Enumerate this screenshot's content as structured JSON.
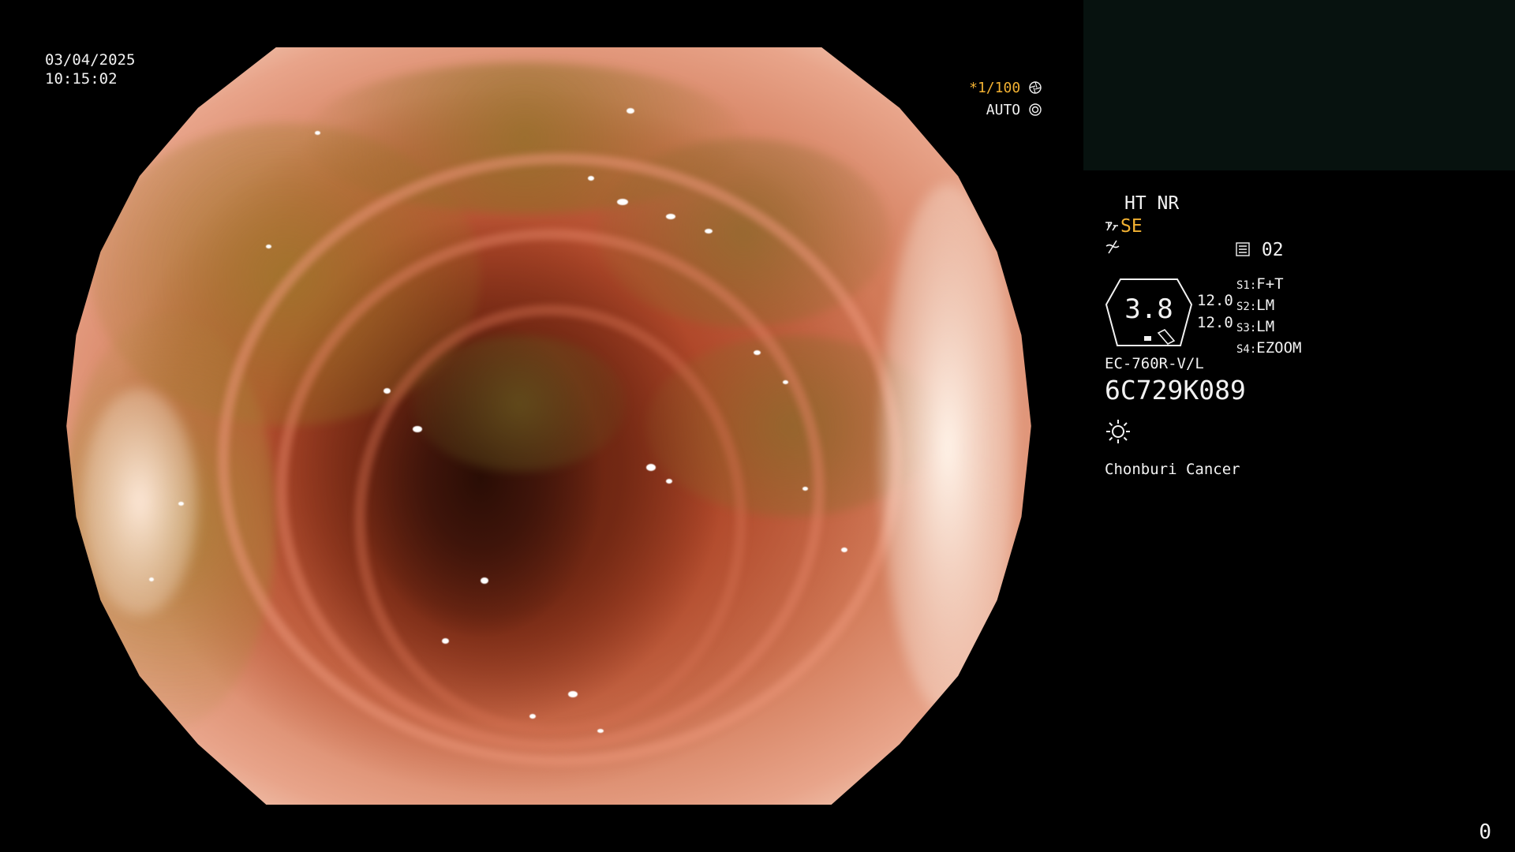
{
  "header": {
    "date": "03/04/2025",
    "time": "10:15:02"
  },
  "exposure": {
    "shutter_prefix": "*",
    "shutter_value": "1/100",
    "shutter_icon": "aperture-icon",
    "mode_label": "AUTO",
    "mode_icon": "iris-icon"
  },
  "processing": {
    "ht_nr": "HT NR",
    "se_value": "SE",
    "se_icon": "structure-enhancement-icon",
    "contrast_icon": "contrast-off-icon",
    "memory_value": "02",
    "memory_icon": "memory-card-icon"
  },
  "gauge": {
    "value": "3.8",
    "side_value_a": "12.0",
    "side_value_b": "12.0"
  },
  "slots": [
    {
      "key": "S1:",
      "value": "F+T"
    },
    {
      "key": "S2:",
      "value": "LM"
    },
    {
      "key": "S3:",
      "value": "LM"
    },
    {
      "key": "S4:",
      "value": "EZOOM"
    }
  ],
  "scope": {
    "model": "EC-760R-V/L",
    "serial": "6C729K089",
    "light_icon": "light-source-icon"
  },
  "institution": "Chonburi Cancer",
  "frame_counter": "0",
  "colors": {
    "accent": "#f2b132",
    "text": "#f2f2f2",
    "panel": "#07120f"
  }
}
